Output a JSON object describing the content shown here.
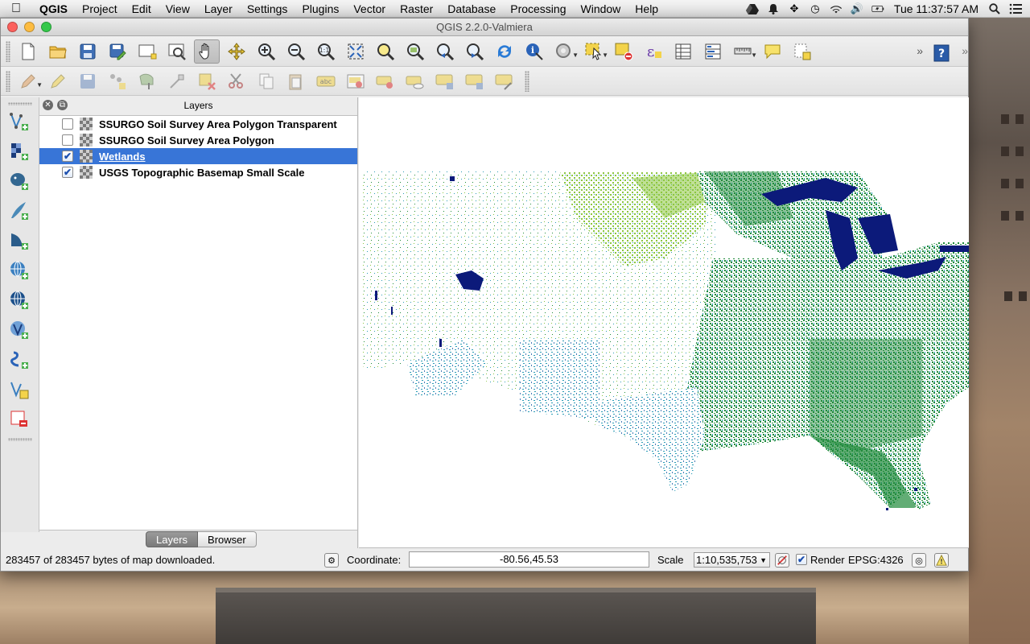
{
  "menubar": {
    "app": "QGIS",
    "items": [
      "Project",
      "Edit",
      "View",
      "Layer",
      "Settings",
      "Plugins",
      "Vector",
      "Raster",
      "Database",
      "Processing",
      "Window",
      "Help"
    ],
    "clock": "Tue 11:37:57 AM",
    "status_icons": [
      "google-drive-icon",
      "notification-bell-icon",
      "move-icon",
      "time-machine-icon",
      "wifi-icon",
      "volume-icon",
      "battery-icon",
      "spotlight-search-icon",
      "notification-center-icon"
    ]
  },
  "window": {
    "title": "QGIS 2.2.0-Valmiera"
  },
  "toolbar1": {
    "icons": [
      "new-project-icon",
      "open-project-icon",
      "save-project-icon",
      "save-as-icon",
      "new-print-composer-icon",
      "composer-manager-icon",
      "pan-icon",
      "pan-to-selection-icon",
      "zoom-in-icon",
      "zoom-out-icon",
      "zoom-actual-size-icon",
      "zoom-full-icon",
      "zoom-to-selection-icon",
      "zoom-to-layer-icon",
      "zoom-last-icon",
      "zoom-next-icon",
      "refresh-icon",
      "identify-icon",
      "action-icon",
      "select-features-icon",
      "deselect-icon",
      "field-calculator-icon",
      "attribute-table-icon",
      "statistics-icon",
      "measure-icon",
      "map-tips-icon",
      "new-bookmark-icon"
    ]
  },
  "toolbar2": {
    "icons": [
      "current-edits-icon",
      "toggle-editing-icon",
      "save-layer-edits-icon",
      "add-feature-icon",
      "move-feature-icon",
      "node-tool-icon",
      "delete-selected-icon",
      "cut-features-icon",
      "copy-features-icon",
      "paste-features-icon",
      "label-icon",
      "label-pin-icon",
      "label-show-hide-icon",
      "label-move-icon",
      "label-rotate-icon",
      "label-change-icon",
      "label-edit-icon"
    ]
  },
  "left_tools": {
    "icons": [
      "add-vector-layer-icon",
      "add-raster-layer-icon",
      "add-postgis-layer-icon",
      "add-spatialite-layer-icon",
      "add-mssql-layer-icon",
      "add-wms-layer-icon",
      "add-wcs-layer-icon",
      "add-wfs-layer-icon",
      "add-delimited-text-layer-icon",
      "new-vector-layer-icon",
      "remove-layer-icon"
    ]
  },
  "layers_panel": {
    "title": "Layers",
    "layers": [
      {
        "name": "SSURGO Soil Survey Area Polygon Transparent",
        "checked": false,
        "selected": false
      },
      {
        "name": "SSURGO Soil Survey Area Polygon",
        "checked": false,
        "selected": false
      },
      {
        "name": "Wetlands",
        "checked": true,
        "selected": true
      },
      {
        "name": "USGS Topographic Basemap Small Scale",
        "checked": true,
        "selected": false
      }
    ],
    "tabs": [
      "Layers",
      "Browser"
    ]
  },
  "statusbar": {
    "message": "283457 of 283457 bytes of map downloaded.",
    "coordinate_label": "Coordinate:",
    "coordinate_value": "-80.56,45.53",
    "scale_label": "Scale",
    "scale_value": "1:10,535,753",
    "render_label": "Render",
    "render_checked": true,
    "crs_label": "EPSG:4326"
  },
  "colors": {
    "selection": "#3875d7",
    "wetland_dark_green": "#1f8a3a",
    "wetland_light_green": "#8cc63f",
    "wetland_teal": "#2a9bb5",
    "lakes_navy": "#0c1a7a"
  }
}
